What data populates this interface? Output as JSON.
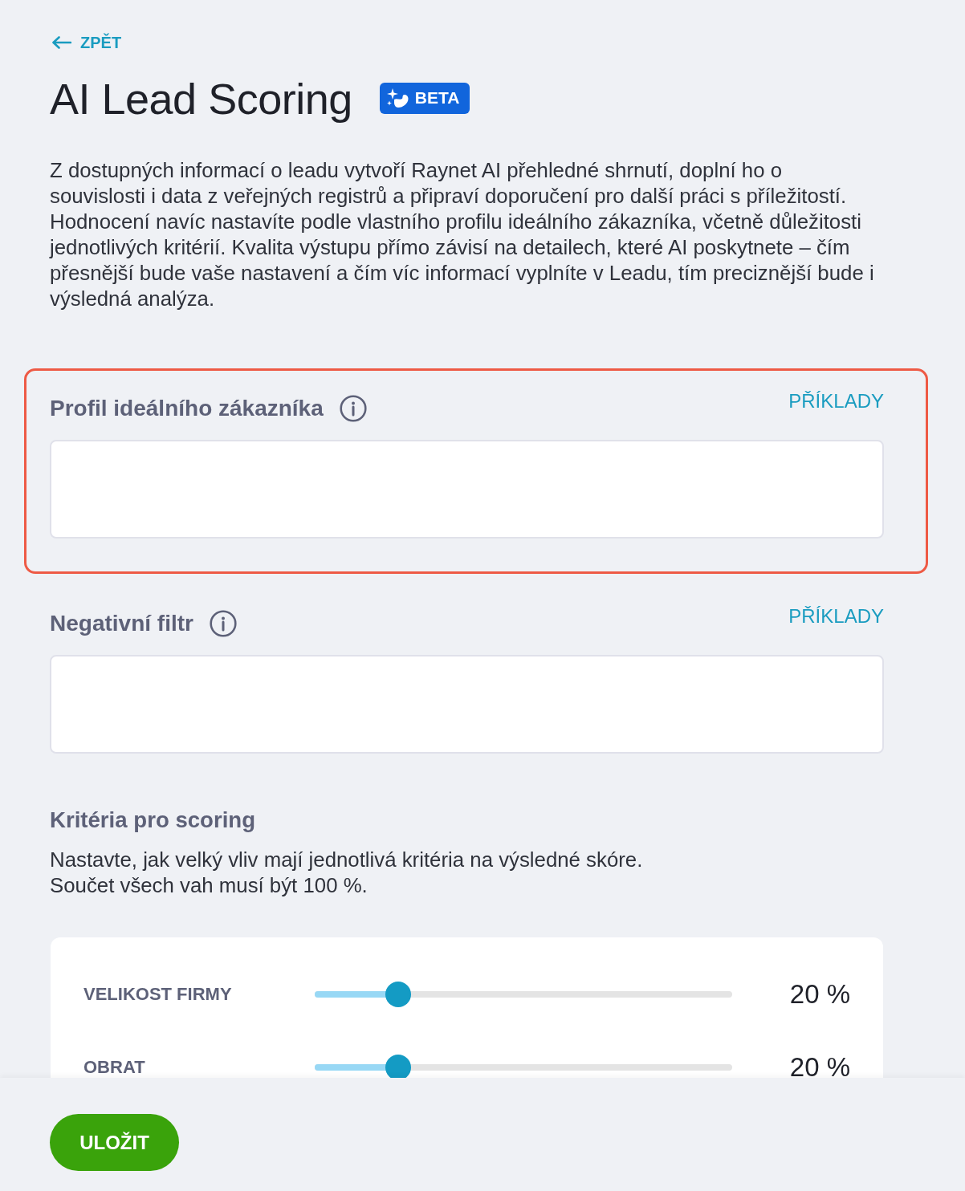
{
  "back_link": {
    "label": "ZPĚT"
  },
  "header": {
    "title": "AI Lead Scoring",
    "badge": "BETA"
  },
  "description": "Z dostupných informací o leadu vytvoří Raynet AI přehledné shrnutí, doplní ho o souvislosti i data z veřejných registrů a připraví doporučení pro další práci s příležitostí. Hodnocení navíc nastavíte podle vlastního profilu ideálního zákazníka, včetně důležitosti jednotlivých kritérií. Kvalita výstupu přímo závisí na detailech, které AI poskytnete – čím přesnější bude vaše nastavení a čím víc informací vyplníte v Leadu, tím preciznější bude i výsledná analýza.",
  "fields": [
    {
      "label": "Profil ideálního zákazníka",
      "examples_link": "PŘÍKLADY",
      "highlighted": true
    },
    {
      "label": "Negativní filtr",
      "examples_link": "PŘÍKLADY",
      "highlighted": false
    }
  ],
  "criteria": {
    "heading": "Kritéria pro scoring",
    "hint_lines": [
      "Nastavte, jak velký vliv mají jednotlivá kritéria na výsledné skóre.",
      "Součet všech vah musí být 100 %."
    ],
    "sliders": [
      {
        "name": "VELIKOST FIRMY",
        "level": 0.2,
        "reading": "20 %"
      },
      {
        "name": "OBRAT",
        "level": 0.2,
        "reading": "20 %"
      }
    ]
  },
  "footer": {
    "save_button": "ULOŽIT"
  }
}
